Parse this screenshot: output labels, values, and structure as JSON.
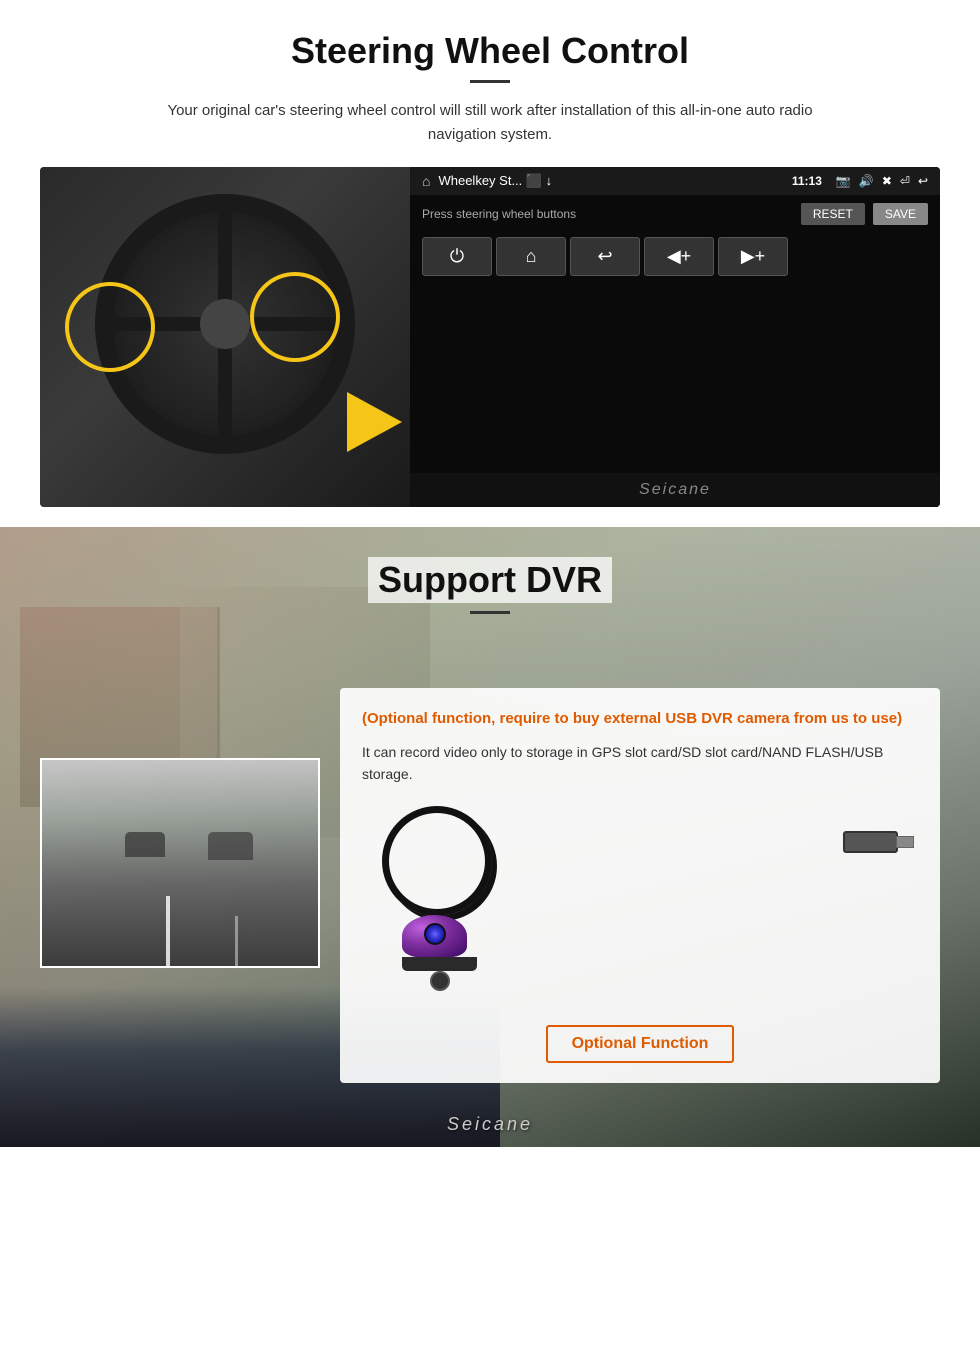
{
  "steering": {
    "title": "Steering Wheel Control",
    "subtitle": "Your original car's steering wheel control will still work after installation of this all-in-one auto radio navigation system.",
    "screen": {
      "app_title": "Wheelkey St... ⬛ ↓",
      "time": "11:13",
      "press_label": "Press steering wheel buttons",
      "btn_reset": "RESET",
      "btn_save": "SAVE",
      "buttons": [
        "⏻",
        "⌂",
        "↩",
        "◀+",
        "▶+"
      ]
    },
    "watermark": "Seicane"
  },
  "dvr": {
    "title": "Support DVR",
    "optional_text": "(Optional function, require to buy external USB DVR camera from us to use)",
    "description": "It can record video only to storage in GPS slot card/SD slot card/NAND FLASH/USB storage.",
    "optional_function_label": "Optional Function",
    "watermark": "Seicane"
  }
}
